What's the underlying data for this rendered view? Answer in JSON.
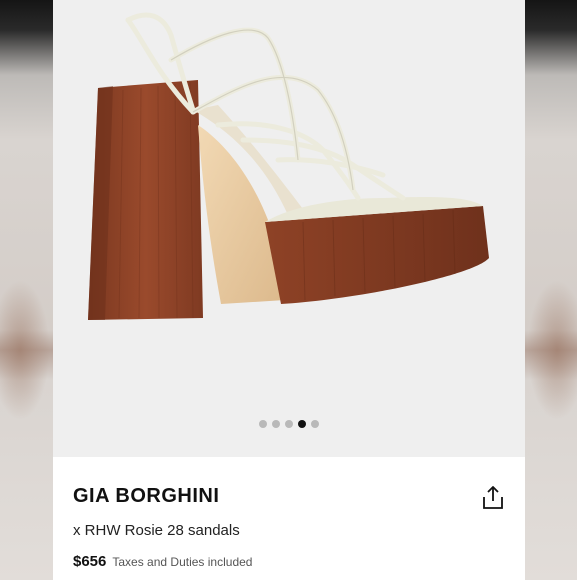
{
  "product": {
    "brand": "GIA BORGHINI",
    "name": "x RHW Rosie 28 sandals",
    "price": "$656",
    "tax_note": "Taxes and Duties included"
  },
  "carousel": {
    "total": 5,
    "active_index": 3
  },
  "icons": {
    "share": "share-icon"
  },
  "colors": {
    "heel_wood": "#8a3f24",
    "strap_cream": "#ecebdd",
    "active_dot": "#111111",
    "inactive_dot": "#b9b9b9"
  }
}
